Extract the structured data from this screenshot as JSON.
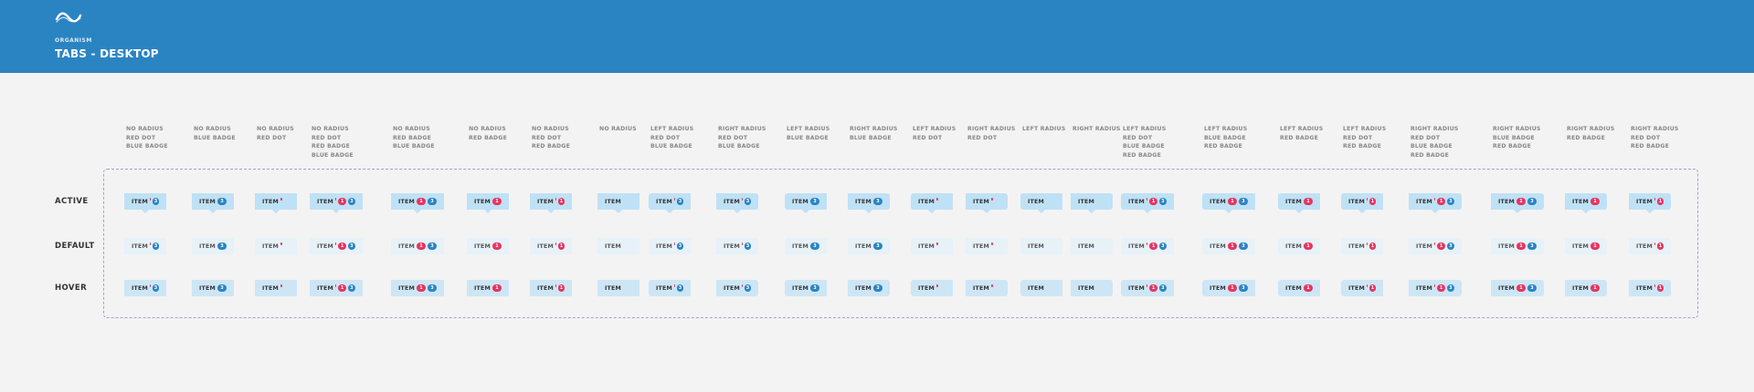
{
  "header": {
    "eyebrow": "ORGANISM",
    "title": "TABS - DESKTOP",
    "background": "#2b84c2",
    "logo_icon": "wave-logo-icon"
  },
  "rows": [
    {
      "label": "ACTIVE",
      "state": "active"
    },
    {
      "label": "DEFAULT",
      "state": "default"
    },
    {
      "label": "HOVER",
      "state": "hover"
    }
  ],
  "tab_label": "ITEM",
  "badge_values": {
    "red": "1",
    "blue": "3"
  },
  "colors": {
    "active_bg": "#bfe1f6",
    "default_bg": "#e7f1f8",
    "hover_bg": "#cde6f6",
    "dot": "#e8345e",
    "badge_red": "#e8345e",
    "badge_blue": "#2b84c2",
    "frame_border": "#a99ce3"
  },
  "variants": [
    {
      "header": "NO RADIUS\nRED DOT\nBLUE BADGE",
      "radius": "none",
      "dot": true,
      "red": false,
      "blue": true
    },
    {
      "header": "NO RADIUS\nBLUE BADGE",
      "radius": "none",
      "dot": false,
      "red": false,
      "blue": true
    },
    {
      "header": "NO RADIUS\nRED DOT",
      "radius": "none",
      "dot": true,
      "red": false,
      "blue": false
    },
    {
      "header": "NO RADIUS\nRED DOT\nRED BADGE\nBLUE BADGE",
      "radius": "none",
      "dot": true,
      "red": true,
      "blue": true
    },
    {
      "header": "NO RADIUS\nRED BADGE\nBLUE BADGE",
      "radius": "none",
      "dot": false,
      "red": true,
      "blue": true
    },
    {
      "header": "NO RADIUS\nRED BADGE",
      "radius": "none",
      "dot": false,
      "red": true,
      "blue": false
    },
    {
      "header": "NO RADIUS\nRED DOT\nRED BADGE",
      "radius": "none",
      "dot": true,
      "red": true,
      "blue": false
    },
    {
      "header": "NO RADIUS",
      "radius": "none",
      "dot": false,
      "red": false,
      "blue": false
    },
    {
      "header": "LEFT RADIUS\nRED DOT\nBLUE BADGE",
      "radius": "left",
      "dot": true,
      "red": false,
      "blue": true
    },
    {
      "header": "RIGHT RADIUS\nRED DOT\nBLUE BADGE",
      "radius": "right",
      "dot": true,
      "red": false,
      "blue": true
    },
    {
      "header": "LEFT RADIUS\nBLUE BADGE",
      "radius": "left",
      "dot": false,
      "red": false,
      "blue": true
    },
    {
      "header": "RIGHT RADIUS\nBLUE BADGE",
      "radius": "right",
      "dot": false,
      "red": false,
      "blue": true
    },
    {
      "header": "LEFT RADIUS\nRED DOT",
      "radius": "left",
      "dot": true,
      "red": false,
      "blue": false
    },
    {
      "header": "RIGHT RADIUS\nRED DOT",
      "radius": "right",
      "dot": true,
      "red": false,
      "blue": false
    },
    {
      "header": "LEFT RADIUS",
      "radius": "left",
      "dot": false,
      "red": false,
      "blue": false
    },
    {
      "header": "RIGHT RADIUS",
      "radius": "right",
      "dot": false,
      "red": false,
      "blue": false
    },
    {
      "header": "LEFT RADIUS\nRED DOT\nBLUE BADGE\nRED BADGE",
      "radius": "left",
      "dot": true,
      "red": true,
      "blue": true
    },
    {
      "header": "LEFT RADIUS\nBLUE BADGE\nRED BADGE",
      "radius": "left",
      "dot": false,
      "red": true,
      "blue": true
    },
    {
      "header": "LEFT RADIUS\nRED BADGE",
      "radius": "left",
      "dot": false,
      "red": true,
      "blue": false
    },
    {
      "header": "LEFT RADIUS\nRED DOT\nRED BADGE",
      "radius": "left",
      "dot": true,
      "red": true,
      "blue": false
    },
    {
      "header": "RIGHT RADIUS\nRED DOT\nBLUE BADGE\nRED BADGE",
      "radius": "right",
      "dot": true,
      "red": true,
      "blue": true
    },
    {
      "header": "RIGHT RADIUS\nBLUE BADGE\nRED BADGE",
      "radius": "right",
      "dot": false,
      "red": true,
      "blue": true
    },
    {
      "header": "RIGHT RADIUS\nRED BADGE",
      "radius": "right",
      "dot": false,
      "red": true,
      "blue": false
    },
    {
      "header": "RIGHT RADIUS\nRED DOT\nRED BADGE",
      "radius": "right",
      "dot": true,
      "red": true,
      "blue": false
    }
  ]
}
